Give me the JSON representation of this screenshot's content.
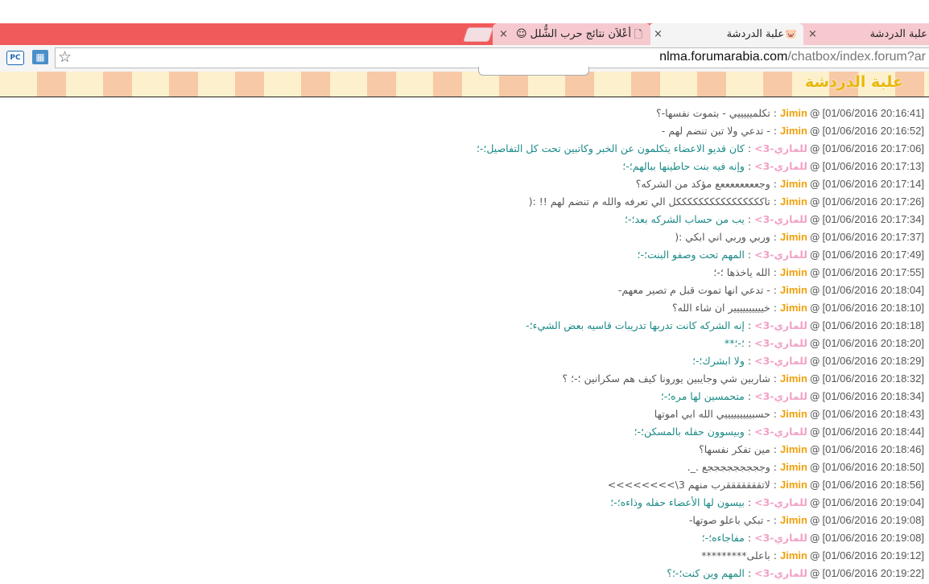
{
  "browser": {
    "tabs": [
      {
        "title": "علبة الدردشة",
        "close": "×"
      },
      {
        "title": "علبة الدردشة",
        "close": "×",
        "favicon": "pig-icon"
      },
      {
        "title": "أعْلاَن نتائج حرب الشُّلل ☺",
        "close": "×",
        "favicon": "page-icon"
      }
    ],
    "url_host": "nlma.forumarabia.com",
    "url_path": "/chatbox/index.forum?ar",
    "pc_label": "PC"
  },
  "banner": {
    "title": "علبة الدردشة"
  },
  "chat": {
    "messages": [
      {
        "time": "[01/06/2016 20:16:41]",
        "user": "Jimin",
        "kind": "j",
        "text": "تكلميييييي - بتموت نفسها-؟"
      },
      {
        "time": "[01/06/2016 20:16:52]",
        "user": "Jimin",
        "kind": "j",
        "text": "- تدعي ولا تبن تنضم لهم -"
      },
      {
        "time": "[01/06/2016 20:17:06]",
        "user": "للماري-3>",
        "kind": "l",
        "text": "كان قديو الاعضاء يتكلمون عن الخبر وكاتبين تحت كل التفاصيل؛-؛"
      },
      {
        "time": "[01/06/2016 20:17:13]",
        "user": "للماري-3>",
        "kind": "l",
        "text": "وإنه فيه بنت حاطينها ببالهم؛-؛"
      },
      {
        "time": "[01/06/2016 20:17:14]",
        "user": "Jimin",
        "kind": "j",
        "text": "وجععععععععع مؤكد من الشركه؟"
      },
      {
        "time": "[01/06/2016 20:17:26]",
        "user": "Jimin",
        "kind": "j",
        "text": "تاككككككككككككككككل الي تعرفه والله م تنضم لهم !! :("
      },
      {
        "time": "[01/06/2016 20:17:34]",
        "user": "للماري-3>",
        "kind": "l",
        "text": "يب من حساب الشركه بعد؛-؛"
      },
      {
        "time": "[01/06/2016 20:17:37]",
        "user": "Jimin",
        "kind": "j",
        "text": "وربي وربي اني ابكي :("
      },
      {
        "time": "[01/06/2016 20:17:49]",
        "user": "للماري-3>",
        "kind": "l",
        "text": "المهم تحت وصفو البنت؛-؛"
      },
      {
        "time": "[01/06/2016 20:17:55]",
        "user": "Jimin",
        "kind": "j",
        "text": "الله ياخذها ؛-؛"
      },
      {
        "time": "[01/06/2016 20:18:04]",
        "user": "Jimin",
        "kind": "j",
        "text": "- تدعي انها تموت قبل م تصير معهم-"
      },
      {
        "time": "[01/06/2016 20:18:10]",
        "user": "Jimin",
        "kind": "j",
        "text": "خيييييييييير ان شاء الله؟"
      },
      {
        "time": "[01/06/2016 20:18:18]",
        "user": "للماري-3>",
        "kind": "l",
        "text": "إنه الشركه كانت تدربها تدريبات قاسيه بعض الشيء؛-"
      },
      {
        "time": "[01/06/2016 20:18:20]",
        "user": "للماري-3>",
        "kind": "l",
        "text": "؛-؛**"
      },
      {
        "time": "[01/06/2016 20:18:29]",
        "user": "للماري-3>",
        "kind": "l",
        "text": "ولا ابشرك؛-؛"
      },
      {
        "time": "[01/06/2016 20:18:32]",
        "user": "Jimin",
        "kind": "j",
        "text": "شاربين شي وجايبين يورونا كيف هم سكرانين ؛-؛ ؟"
      },
      {
        "time": "[01/06/2016 20:18:34]",
        "user": "للماري-3>",
        "kind": "l",
        "text": "متحمسين لها مره؛-؛"
      },
      {
        "time": "[01/06/2016 20:18:43]",
        "user": "Jimin",
        "kind": "j",
        "text": "حسبيييييييييي الله ابي اموتها"
      },
      {
        "time": "[01/06/2016 20:18:44]",
        "user": "للماري-3>",
        "kind": "l",
        "text": "وبيسوون حفله بالمسكن؛-؛"
      },
      {
        "time": "[01/06/2016 20:18:46]",
        "user": "Jimin",
        "kind": "j",
        "text": "مين تفكر نفسها؟"
      },
      {
        "time": "[01/06/2016 20:18:50]",
        "user": "Jimin",
        "kind": "j",
        "text": "وجججججججججع ._."
      },
      {
        "time": "[01/06/2016 20:18:56]",
        "user": "Jimin",
        "kind": "j",
        "text": "لاتقققققققرب منهم 3\\>>>>>>>>"
      },
      {
        "time": "[01/06/2016 20:19:04]",
        "user": "للماري-3>",
        "kind": "l",
        "text": "بيسون لها الأعضاء حفله وذاءه؛-؛"
      },
      {
        "time": "[01/06/2016 20:19:08]",
        "user": "Jimin",
        "kind": "j",
        "text": "- تبكي باعلو صوتها-"
      },
      {
        "time": "[01/06/2016 20:19:08]",
        "user": "للماري-3>",
        "kind": "l",
        "text": "مفاجاءه؛-؛"
      },
      {
        "time": "[01/06/2016 20:19:12]",
        "user": "Jimin",
        "kind": "j",
        "text": "باعلى*********"
      },
      {
        "time": "[01/06/2016 20:19:22]",
        "user": "للماري-3>",
        "kind": "l",
        "text": "المهم وين كنت؛-؛؟"
      }
    ]
  },
  "colors": {
    "tabbar": "#f05a5a",
    "jimin": "#f0a00a",
    "lolmari": "#f2a1c6",
    "msg_l": "#1a8a86",
    "banner_title": "#e8b80b"
  }
}
